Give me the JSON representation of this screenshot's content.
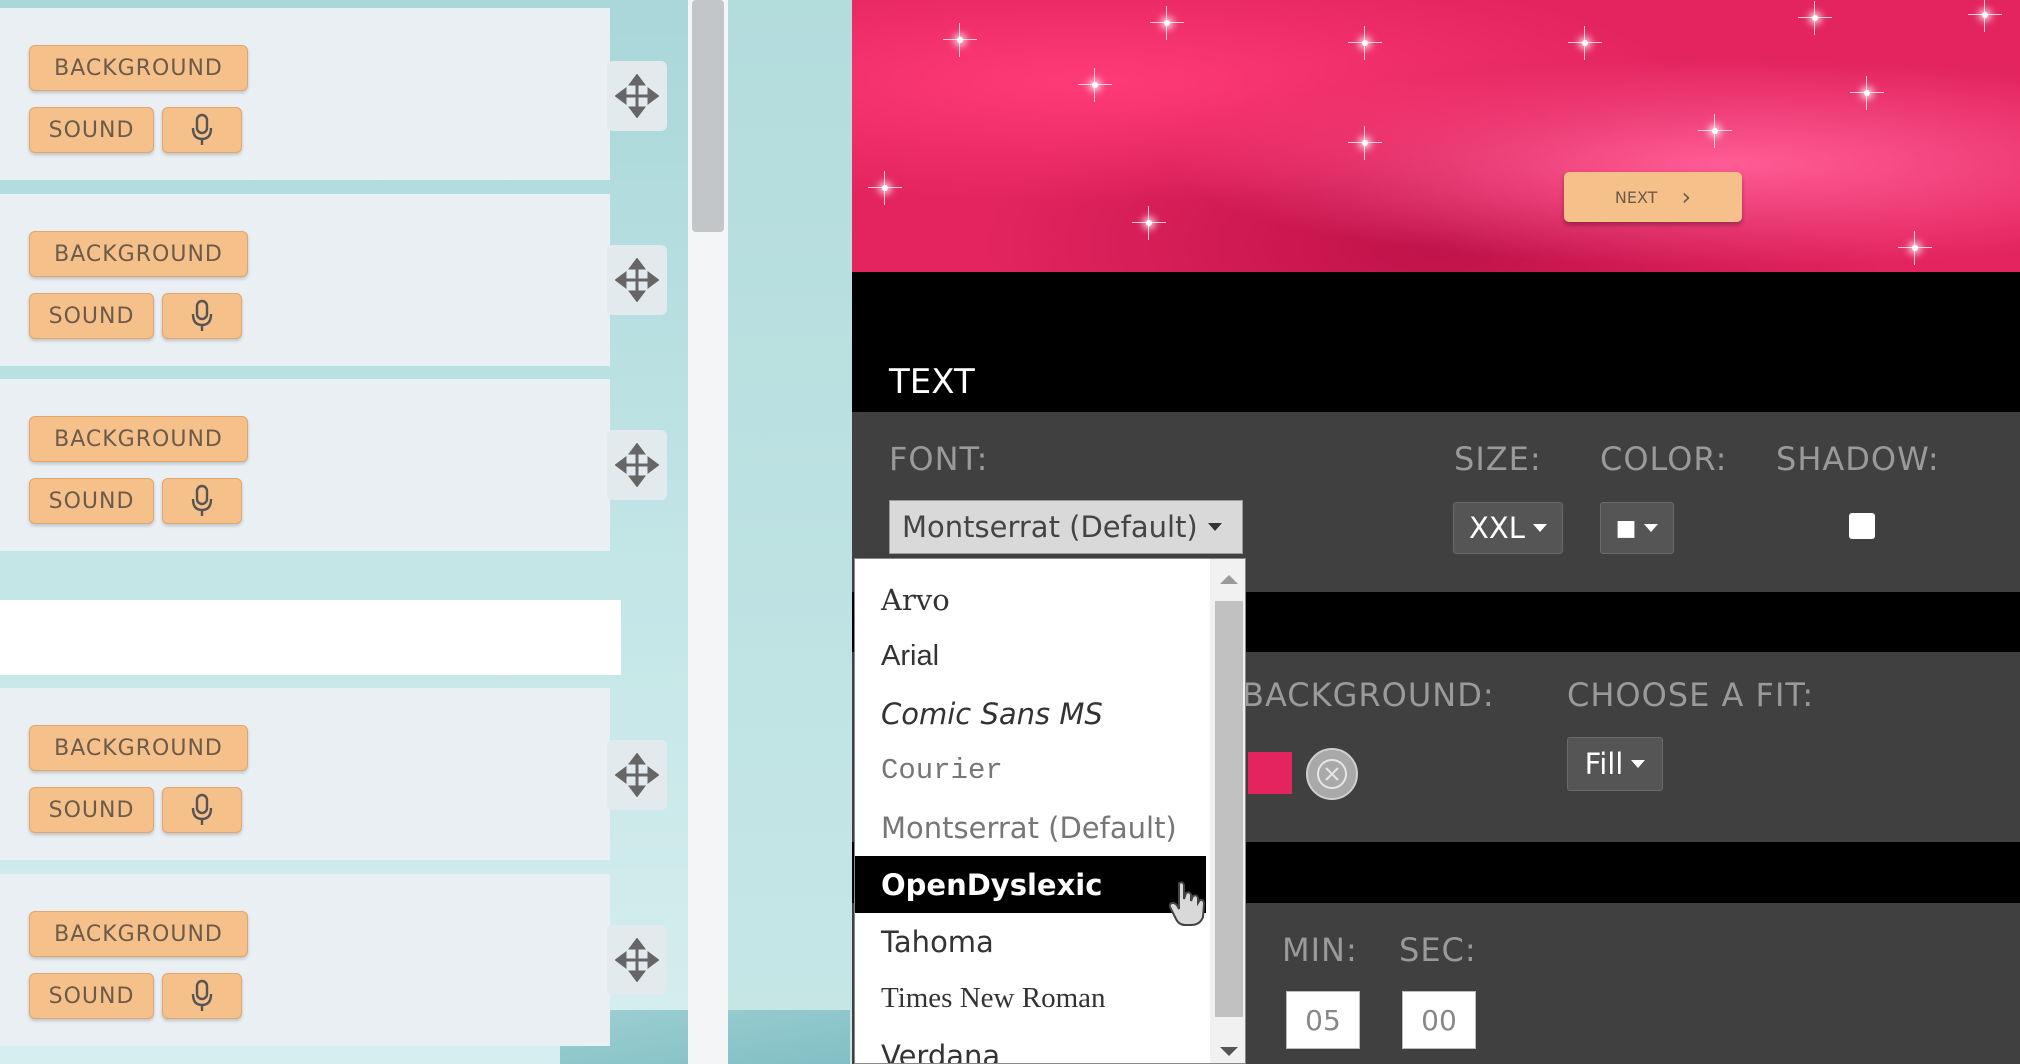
{
  "slides": [
    {
      "background_label": "BACKGROUND",
      "sound_label": "SOUND"
    },
    {
      "background_label": "BACKGROUND",
      "sound_label": "SOUND"
    },
    {
      "background_label": "BACKGROUND",
      "sound_label": "SOUND"
    },
    {
      "background_label": "BACKGROUND",
      "sound_label": "SOUND"
    },
    {
      "background_label": "BACKGROUND",
      "sound_label": "SOUND"
    }
  ],
  "preview": {
    "next_label": "NEXT"
  },
  "text_section": {
    "heading": "TEXT",
    "font_label": "FONT:",
    "font_value": "Montserrat (Default)",
    "size_label": "SIZE:",
    "size_value": "XXL",
    "color_label": "COLOR:",
    "color_value": "■",
    "shadow_label": "SHADOW:"
  },
  "background_section": {
    "background_label": "BACKGROUND:",
    "fit_label": "CHOOSE A FIT:",
    "fit_value": "Fill"
  },
  "timer_section": {
    "min_label": "MIN:",
    "min_value": "05",
    "sec_label": "SEC:",
    "sec_value": "00"
  },
  "font_dropdown": {
    "options": [
      "Arvo",
      "Arial",
      "Comic Sans MS",
      "Courier",
      "Montserrat (Default)",
      "OpenDyslexic",
      "Tahoma",
      "Times New Roman",
      "Verdana"
    ],
    "highlighted": "OpenDyslexic"
  },
  "colors": {
    "button_orange": "#f6c08a",
    "panel_dark": "#404040",
    "preview_pink": "#e3245f"
  }
}
